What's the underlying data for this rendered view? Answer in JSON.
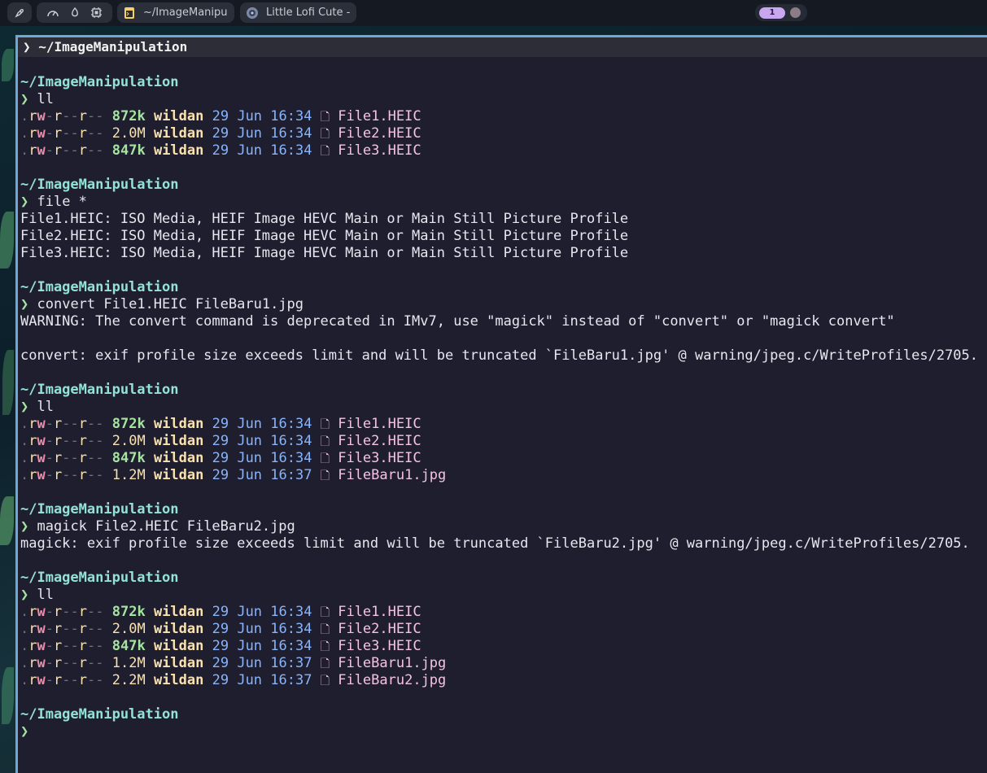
{
  "topbar": {
    "app_title": "~/ImageManipu",
    "media_title": "Little Lofi Cute -",
    "workspace_active": "1"
  },
  "terminal": {
    "title": "❯ ~/ImageManipulation",
    "cwd": "~/ImageManipulation",
    "prompt": "❯",
    "blocks": [
      {
        "cmd": "ll",
        "listing": [
          {
            "perms": ".rw-r--r--",
            "size": "872k",
            "user": "wildan",
            "date": "29 Jun 16:34",
            "name": "File1.HEIC"
          },
          {
            "perms": ".rw-r--r--",
            "size": "2.0M",
            "user": "wildan",
            "date": "29 Jun 16:34",
            "name": "File2.HEIC"
          },
          {
            "perms": ".rw-r--r--",
            "size": "847k",
            "user": "wildan",
            "date": "29 Jun 16:34",
            "name": "File3.HEIC"
          }
        ]
      },
      {
        "cmd": "file *",
        "output": [
          "File1.HEIC: ISO Media, HEIF Image HEVC Main or Main Still Picture Profile",
          "File2.HEIC: ISO Media, HEIF Image HEVC Main or Main Still Picture Profile",
          "File3.HEIC: ISO Media, HEIF Image HEVC Main or Main Still Picture Profile"
        ]
      },
      {
        "cmd": "convert File1.HEIC FileBaru1.jpg",
        "output": [
          "WARNING: The convert command is deprecated in IMv7, use \"magick\" instead of \"convert\" or \"magick convert\"",
          "",
          "convert: exif profile size exceeds limit and will be truncated `FileBaru1.jpg' @ warning/jpeg.c/WriteProfiles/2705."
        ]
      },
      {
        "cmd": "ll",
        "listing": [
          {
            "perms": ".rw-r--r--",
            "size": "872k",
            "user": "wildan",
            "date": "29 Jun 16:34",
            "name": "File1.HEIC"
          },
          {
            "perms": ".rw-r--r--",
            "size": "2.0M",
            "user": "wildan",
            "date": "29 Jun 16:34",
            "name": "File2.HEIC"
          },
          {
            "perms": ".rw-r--r--",
            "size": "847k",
            "user": "wildan",
            "date": "29 Jun 16:34",
            "name": "File3.HEIC"
          },
          {
            "perms": ".rw-r--r--",
            "size": "1.2M",
            "user": "wildan",
            "date": "29 Jun 16:37",
            "name": "FileBaru1.jpg"
          }
        ]
      },
      {
        "cmd": "magick File2.HEIC FileBaru2.jpg",
        "output": [
          "magick: exif profile size exceeds limit and will be truncated `FileBaru2.jpg' @ warning/jpeg.c/WriteProfiles/2705."
        ]
      },
      {
        "cmd": "ll",
        "listing": [
          {
            "perms": ".rw-r--r--",
            "size": "872k",
            "user": "wildan",
            "date": "29 Jun 16:34",
            "name": "File1.HEIC"
          },
          {
            "perms": ".rw-r--r--",
            "size": "2.0M",
            "user": "wildan",
            "date": "29 Jun 16:34",
            "name": "File2.HEIC"
          },
          {
            "perms": ".rw-r--r--",
            "size": "847k",
            "user": "wildan",
            "date": "29 Jun 16:34",
            "name": "File3.HEIC"
          },
          {
            "perms": ".rw-r--r--",
            "size": "1.2M",
            "user": "wildan",
            "date": "29 Jun 16:37",
            "name": "FileBaru1.jpg"
          },
          {
            "perms": ".rw-r--r--",
            "size": "2.2M",
            "user": "wildan",
            "date": "29 Jun 16:37",
            "name": "FileBaru2.jpg"
          }
        ]
      }
    ]
  }
}
